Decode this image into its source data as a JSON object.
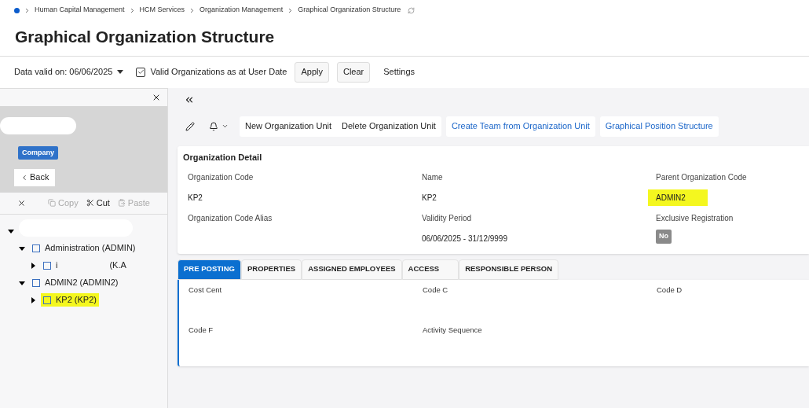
{
  "breadcrumb": [
    "Human Capital Management",
    "HCM Services",
    "Organization Management",
    "Graphical Organization Structure"
  ],
  "title": "Graphical Organization Structure",
  "filter_bar": {
    "date_label": "Data valid on: 06/06/2025",
    "valid_orgs": {
      "label": "Valid Organizations as at User Date",
      "checked": true
    },
    "buttons": [
      "Apply",
      "Clear",
      "Settings"
    ]
  },
  "side_panel": {
    "badge": "Company",
    "back": "Back",
    "actions": [
      {
        "label": "Copy",
        "disabled": true
      },
      {
        "label": "Cut",
        "disabled": false
      },
      {
        "label": "Paste",
        "disabled": true
      }
    ],
    "tree": [
      {
        "expanded": true,
        "redacted": true,
        "children": [
          {
            "label_parts": [
              "Administration (ADMIN)"
            ],
            "expanded": true,
            "highlighted": false,
            "children": [
              {
                "label_parts": [
                  "i",
                  "(K.A"
                ],
                "expanded": false,
                "highlighted": false
              }
            ]
          },
          {
            "label_parts": [
              "ADMIN2 (ADMIN2)"
            ],
            "expanded": true,
            "highlighted": false,
            "children": [
              {
                "label_parts": [
                  "KP2 (KP2)"
                ],
                "expanded": false,
                "highlighted": true
              }
            ]
          }
        ]
      }
    ]
  },
  "toolbar": {
    "plain_buttons": [
      "New Organization Unit",
      "Delete Organization Unit"
    ],
    "link_buttons": [
      "Create Team from Organization Unit",
      "Graphical Position Structure"
    ]
  },
  "detail": {
    "title": "Organization Detail",
    "fields": [
      {
        "label": "Organization Code",
        "value": "KP2",
        "highlighted": false
      },
      {
        "label": "Name",
        "value": "KP2",
        "highlighted": false
      },
      {
        "label": "Parent Organization Code",
        "value": "ADMIN2",
        "highlighted": true
      },
      {
        "label": "Organization Code Alias",
        "kind": "text"
      },
      {
        "label": "Validity Period",
        "value": "06/06/2025 - 31/12/9999",
        "highlighted": false
      },
      {
        "label": "Exclusive Registration",
        "kind": "badge",
        "value": "No"
      }
    ]
  },
  "tabs": [
    {
      "label": "PRE POSTING",
      "selected": true
    },
    {
      "label": "PROPERTIES",
      "selected": false
    },
    {
      "label": "ASSIGNED EMPLOYEES",
      "selected": false
    },
    {
      "label": "ACCESS",
      "selected": false
    },
    {
      "label": "RESPONSIBLE PERSON",
      "selected": false
    }
  ],
  "tab_fields": [
    "Cost Cent",
    "Code C",
    "Code D",
    "Code F",
    "Activity Sequence"
  ]
}
